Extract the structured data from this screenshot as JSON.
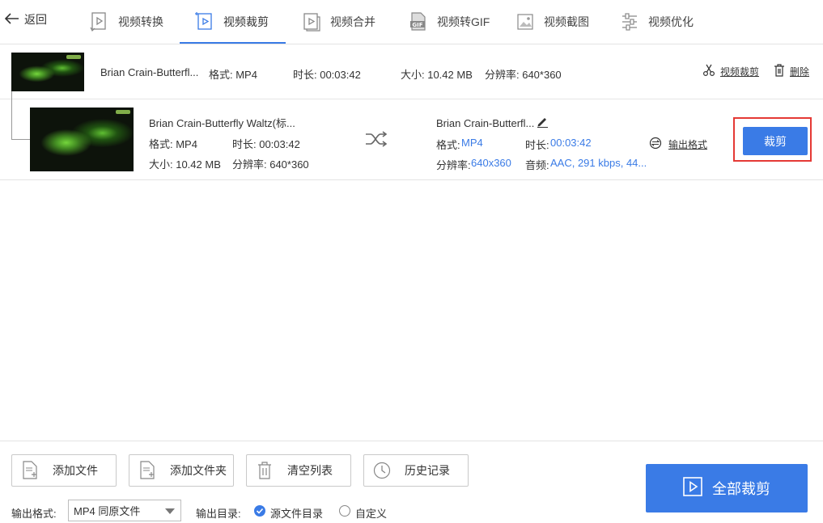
{
  "nav": {
    "back_label": "返回",
    "tabs": [
      {
        "label": "视频转换",
        "icon": "video-convert-icon"
      },
      {
        "label": "视频裁剪",
        "icon": "video-crop-icon",
        "active": true
      },
      {
        "label": "视频合并",
        "icon": "video-merge-icon"
      },
      {
        "label": "视频转GIF",
        "icon": "gif-icon"
      },
      {
        "label": "视频截图",
        "icon": "screenshot-icon"
      },
      {
        "label": "视频优化",
        "icon": "optimize-icon"
      }
    ]
  },
  "file": {
    "name": "Brian Crain-Butterfl...",
    "format": "格式: MP4",
    "duration": "时长: 00:03:42",
    "size": "大小: 10.42 MB",
    "resolution": "分辨率: 640*360",
    "crop_link": "视频裁剪",
    "delete_link": "删除"
  },
  "source": {
    "name": "Brian Crain-Butterfly Waltz(标...",
    "format": "格式: MP4",
    "duration": "时长: 00:03:42",
    "size": "大小: 10.42 MB",
    "resolution": "分辨率: 640*360"
  },
  "output": {
    "name": "Brian Crain-Butterfl...",
    "format_label": "格式:",
    "format_value": "MP4",
    "duration_label": "时长:",
    "duration_value": "00:03:42",
    "resolution_label": "分辨率:",
    "resolution_value": "640x360",
    "audio_label": "音频:",
    "audio_value": "AAC, 291 kbps, 44...",
    "output_format_link": "输出格式",
    "crop_button": "裁剪"
  },
  "bottom": {
    "add_file": "添加文件",
    "add_folder": "添加文件夹",
    "clear_list": "清空列表",
    "history": "历史记录",
    "output_format_label": "输出格式:",
    "output_format_value": "MP4 同原文件",
    "output_dir_label": "输出目录:",
    "dir_source": "源文件目录",
    "dir_custom": "自定义",
    "dir_selected": "源文件目录",
    "crop_all": "全部裁剪"
  },
  "colors": {
    "accent": "#3a7be6",
    "highlight": "#e53935"
  }
}
